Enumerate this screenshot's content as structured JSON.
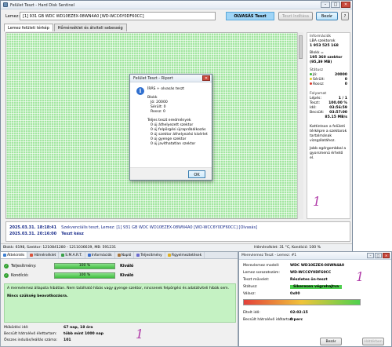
{
  "main": {
    "title": "Felület Teszt - Hard Disk Sentinel",
    "disk_label": "Lemez:",
    "disk_value": "[1] 931 GB  WDC WD10EZEX-08WN4A0 [WD-WCC6Y0DF60CC]",
    "status_badge": "OLVASÁS Teszt",
    "btn_start": "Teszt Indítása",
    "btn_close": "Bezár",
    "tabs": [
      "Lemez felületi térkép",
      "Hőmérséklet és átviteli sebesség"
    ],
    "colors": {
      "map_green": "#a3e6a1",
      "badge_blue": "#9fd5f7"
    }
  },
  "info": {
    "header": "Információk",
    "lba_label": "LBA szektorok",
    "lba_value": "1 953 525 168",
    "block_label": "Blokk =",
    "block_value": "195 360 szektor",
    "block_mb": "(95,39 MB)",
    "status_label": "Státusz",
    "ok_label": "Jó:",
    "ok_value": "20000",
    "damaged_label": "Sérült:",
    "damaged_value": "0",
    "bad_label": "Rossz:",
    "bad_value": "0",
    "progress_header": "Folyamat",
    "step_label": "Lépés:",
    "step_value": "1 / 1",
    "test_label": "Teszt:",
    "test_value": "100.00 %",
    "time_label": "Idő:",
    "time_value": "03:56:59",
    "est_label": "Becsült:",
    "est_value": "03:57:00",
    "speed_value": "85.15 MB/s",
    "hint1": "Kattintson a felületi térképre a szektorok tartalmának vizsgálatához.",
    "hint2": "Jobb egérgombbal a gyorsmenü érhető el."
  },
  "log": [
    {
      "ts": "2025.03.31.  18:18:41",
      "text": "Szekvenciális teszt, Lemez: [1] 931 GB  WDC WD10EZEX-08WN4A0 [WD-WCC6Y0DF60CC] [Olvasás]"
    },
    {
      "ts": "2025.03.31.  20:16:00",
      "text": "Teszt kész"
    }
  ],
  "statusbar": {
    "left": "Blokk: 6198, Szektor: 1210841280 - 1211036639, MB: 591231",
    "right": "Hőmérséklet: 31 °C,  Kondíció: 100 %"
  },
  "report": {
    "title": "Felület Teszt - Riport",
    "heading": "ÍRÁS + olvasás teszt",
    "blocks_label": "Blokk",
    "ok": "Jó: 20000",
    "damaged": "Sérült: 0",
    "bad": "Rossz: 0",
    "results_label": "Teljes teszt eredmények",
    "lines": [
      "0 új áthelyezett szektor",
      "0 új felpörgési újrapróbálkozás",
      "0 új szektor áthelyezési kísérlet",
      "0 új gyenge szektor",
      "0 új javíthatatlan szektor"
    ],
    "ok_button": "OK"
  },
  "overview": {
    "tabs": [
      "Áttekintés",
      "Hőmérséklet",
      "S.M.A.R.T.",
      "Információk",
      "Napló",
      "Teljesítmény",
      "Figyelmeztetések"
    ],
    "rows": [
      {
        "label": "Teljesítmény:",
        "bar": "100 %",
        "value": "Kiváló",
        "progress": 100
      },
      {
        "label": "Kondíció:",
        "bar": "100 %",
        "value": "Kiváló",
        "progress": 100
      }
    ],
    "message": "A merevlemez állapota hibátlan. Nem található hibás vagy gyenge szektor, nincsenek felpörgési és adatátviteli hibák sem.",
    "message_bold": "Nincs szükség beavatkozásra.",
    "stats": [
      {
        "k": "Működési idő:",
        "v": "67 nap, 18 óra"
      },
      {
        "k": "Becsült hátralévő élettartam:",
        "v": "több mint 1000 nap"
      },
      {
        "k": "Összes indulás/leállás száma:",
        "v": "101"
      }
    ]
  },
  "surface": {
    "title": "Merevlemez Teszt - Lemez: #1",
    "rows": [
      {
        "k": "Merevlemez modell:",
        "v": "WDC WD10EZEX-08WN4A0"
      },
      {
        "k": "Lemez sorozatszám:",
        "v": "WD-WCC6Y0DF60CC"
      },
      {
        "k": "Teszt művelet:",
        "v": "Részletes ön-teszt"
      },
      {
        "k": "Státusz:",
        "v": "Sikeresen végrehajtva"
      },
      {
        "k": "Válasz:",
        "v": "0x00"
      }
    ],
    "elapsed_label": "Eltelt idő:",
    "elapsed_value": "02:02:15",
    "remaining_label": "Becsült hátralévő időtartam:",
    "remaining_value": "0 perc",
    "btn_close": "Bezár",
    "btn_help": "Háttérben"
  }
}
